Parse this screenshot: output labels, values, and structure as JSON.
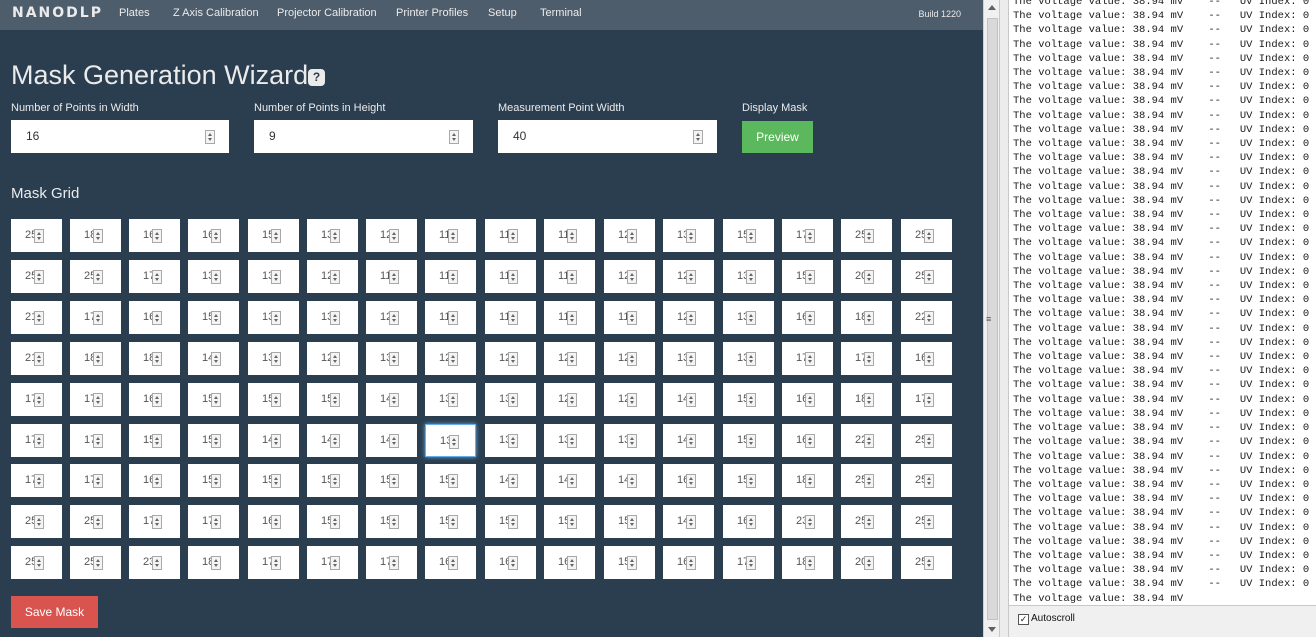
{
  "navbar": {
    "logo": "NANODLP",
    "items": [
      "Plates",
      "Z Axis Calibration",
      "Projector Calibration",
      "Printer Profiles",
      "Setup",
      "Terminal"
    ],
    "build": "Build 1220"
  },
  "page": {
    "title": "Mask Generation Wizard",
    "help_icon": "?"
  },
  "fields": {
    "width_label": "Number of Points in Width",
    "width_value": "16",
    "height_label": "Number of Points in Height",
    "height_value": "9",
    "point_width_label": "Measurement Point Width",
    "point_width_value": "40",
    "display_label": "Display Mask",
    "preview_label": "Preview"
  },
  "grid": {
    "title": "Mask Grid",
    "rows": [
      [
        "25",
        "18",
        "16",
        "16",
        "15",
        "13",
        "12",
        "11",
        "11",
        "11",
        "12",
        "13",
        "15",
        "17",
        "25",
        "25"
      ],
      [
        "25",
        "25",
        "17",
        "13",
        "13",
        "12",
        "11",
        "11",
        "11",
        "11",
        "12",
        "12",
        "13",
        "15",
        "20",
        "25"
      ],
      [
        "21",
        "17",
        "16",
        "15",
        "13",
        "13",
        "12",
        "11",
        "11",
        "11",
        "11",
        "12",
        "13",
        "16",
        "18",
        "22"
      ],
      [
        "21",
        "18",
        "18",
        "14",
        "13",
        "12",
        "13",
        "12",
        "12",
        "12",
        "12",
        "13",
        "13",
        "17",
        "17",
        "16"
      ],
      [
        "17",
        "17",
        "16",
        "15",
        "15",
        "15",
        "14",
        "13",
        "13",
        "12",
        "12",
        "14",
        "15",
        "16",
        "18",
        "17"
      ],
      [
        "17",
        "17",
        "15",
        "15",
        "14",
        "14",
        "14",
        "13",
        "13",
        "13",
        "13",
        "14",
        "15",
        "16",
        "22",
        "25"
      ],
      [
        "17",
        "17",
        "16",
        "15",
        "15",
        "15",
        "15",
        "15",
        "14",
        "14",
        "14",
        "16",
        "15",
        "18",
        "25",
        "25"
      ],
      [
        "25",
        "25",
        "17",
        "17",
        "16",
        "15",
        "15",
        "15",
        "15",
        "15",
        "15",
        "14",
        "16",
        "23",
        "25",
        "25"
      ],
      [
        "25",
        "25",
        "23",
        "18",
        "17",
        "17",
        "17",
        "16",
        "16",
        "16",
        "15",
        "16",
        "17",
        "18",
        "20",
        "25"
      ]
    ],
    "focused_cell": "5-7"
  },
  "save_label": "Save Mask",
  "serial": {
    "lines": [
      "The voltage value: 38.94 mV    --   UV Index: 0",
      "The voltage value: 38.94 mV    --   UV Index: 0",
      "The voltage value: 38.94 mV    --   UV Index: 0",
      "The voltage value: 38.94 mV    --   UV Index: 0",
      "The voltage value: 38.94 mV    --   UV Index: 0",
      "The voltage value: 38.94 mV    --   UV Index: 0",
      "The voltage value: 38.94 mV    --   UV Index: 0",
      "The voltage value: 38.94 mV    --   UV Index: 0",
      "The voltage value: 38.94 mV    --   UV Index: 0",
      "The voltage value: 38.94 mV    --   UV Index: 0",
      "The voltage value: 38.94 mV    --   UV Index: 0",
      "The voltage value: 38.94 mV    --   UV Index: 0",
      "The voltage value: 38.94 mV    --   UV Index: 0",
      "The voltage value: 38.94 mV    --   UV Index: 0",
      "The voltage value: 38.94 mV    --   UV Index: 0",
      "The voltage value: 38.94 mV    --   UV Index: 0",
      "The voltage value: 38.94 mV    --   UV Index: 0",
      "The voltage value: 38.94 mV    --   UV Index: 0",
      "The voltage value: 38.94 mV    --   UV Index: 0",
      "The voltage value: 38.94 mV    --   UV Index: 0",
      "The voltage value: 38.94 mV    --   UV Index: 0",
      "The voltage value: 38.94 mV    --   UV Index: 0",
      "The voltage value: 38.94 mV    --   UV Index: 0",
      "The voltage value: 38.94 mV    --   UV Index: 0",
      "The voltage value: 38.94 mV    --   UV Index: 0",
      "The voltage value: 38.94 mV    --   UV Index: 0",
      "The voltage value: 38.94 mV    --   UV Index: 0",
      "The voltage value: 38.94 mV    --   UV Index: 0",
      "The voltage value: 38.94 mV    --   UV Index: 0",
      "The voltage value: 38.94 mV    --   UV Index: 0",
      "The voltage value: 38.94 mV    --   UV Index: 0",
      "The voltage value: 38.94 mV    --   UV Index: 0",
      "The voltage value: 38.94 mV    --   UV Index: 0",
      "The voltage value: 38.94 mV    --   UV Index: 0",
      "The voltage value: 38.94 mV    --   UV Index: 0",
      "The voltage value: 38.94 mV    --   UV Index: 0",
      "The voltage value: 38.94 mV    --   UV Index: 0",
      "The voltage value: 38.94 mV    --   UV Index: 0",
      "The voltage value: 38.94 mV    --   UV Index: 0",
      "The voltage value: 38.94 mV    --   UV Index: 0",
      "The voltage value: 38.94 mV    --   UV Index: 0",
      "The voltage value: 38.94 mV    --   UV Index: 0",
      "The voltage value: 38.94 mV"
    ],
    "autoscroll_label": "Autoscroll",
    "autoscroll_checked": true
  }
}
